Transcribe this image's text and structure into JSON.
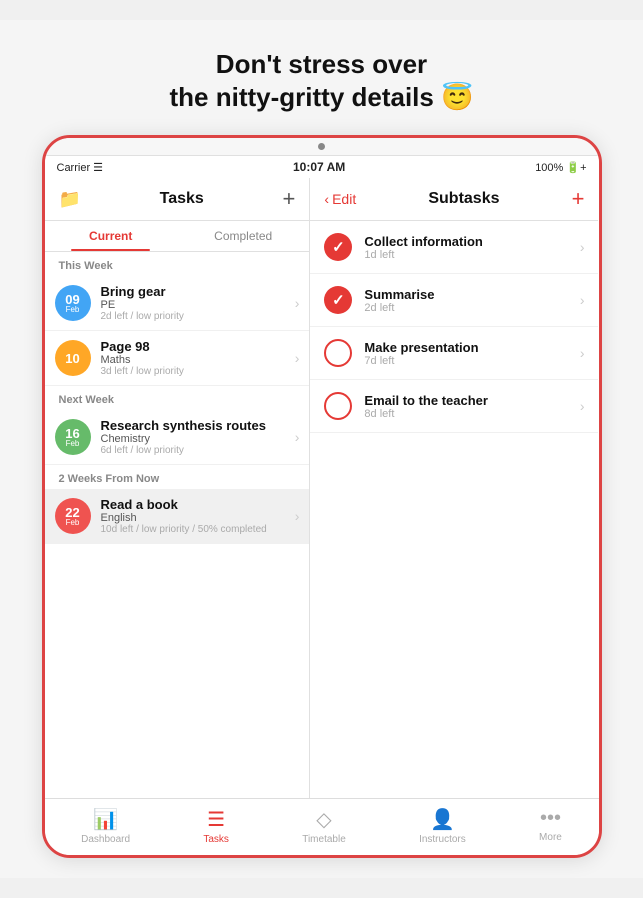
{
  "headline": {
    "line1": "Don't stress over",
    "line2": "the nitty-gritty details 😇"
  },
  "status_bar": {
    "carrier": "Carrier ☰",
    "time": "10:07 AM",
    "battery": "100% 🔋+"
  },
  "left_panel": {
    "icon": "📁",
    "title": "Tasks",
    "add_button": "+",
    "tabs": [
      "Current",
      "Completed"
    ],
    "active_tab": 0,
    "sections": [
      {
        "label": "This Week",
        "tasks": [
          {
            "day": "09",
            "month": "Feb",
            "color": "#42a5f5",
            "name": "Bring gear",
            "subject": "PE",
            "meta": "2d left / low priority"
          },
          {
            "day": "10",
            "month": "",
            "color": "#ffa726",
            "name": "Page 98",
            "subject": "Maths",
            "meta": "3d left / low priority"
          }
        ]
      },
      {
        "label": "Next Week",
        "tasks": [
          {
            "day": "16",
            "month": "Feb",
            "color": "#66bb6a",
            "name": "Research synthesis routes",
            "subject": "Chemistry",
            "meta": "6d left / low priority"
          }
        ]
      },
      {
        "label": "2 Weeks From Now",
        "tasks": [
          {
            "day": "22",
            "month": "Feb",
            "color": "#ef5350",
            "name": "Read a book",
            "subject": "English",
            "meta": "10d left / low priority / 50% completed",
            "selected": true
          }
        ]
      }
    ]
  },
  "right_panel": {
    "edit_label": "Edit",
    "title": "Subtasks",
    "add_button": "+",
    "subtasks": [
      {
        "name": "Collect information",
        "due": "1d left",
        "checked": true
      },
      {
        "name": "Summarise",
        "due": "2d left",
        "checked": true
      },
      {
        "name": "Make presentation",
        "due": "7d left",
        "checked": false
      },
      {
        "name": "Email to the teacher",
        "due": "8d left",
        "checked": false
      }
    ]
  },
  "bottom_nav": {
    "items": [
      {
        "icon": "📊",
        "label": "Dashboard",
        "active": false
      },
      {
        "icon": "☰",
        "label": "Tasks",
        "active": true
      },
      {
        "icon": "◇",
        "label": "Timetable",
        "active": false
      },
      {
        "icon": "👤",
        "label": "Instructors",
        "active": false
      },
      {
        "icon": "•••",
        "label": "More",
        "active": false
      }
    ]
  }
}
